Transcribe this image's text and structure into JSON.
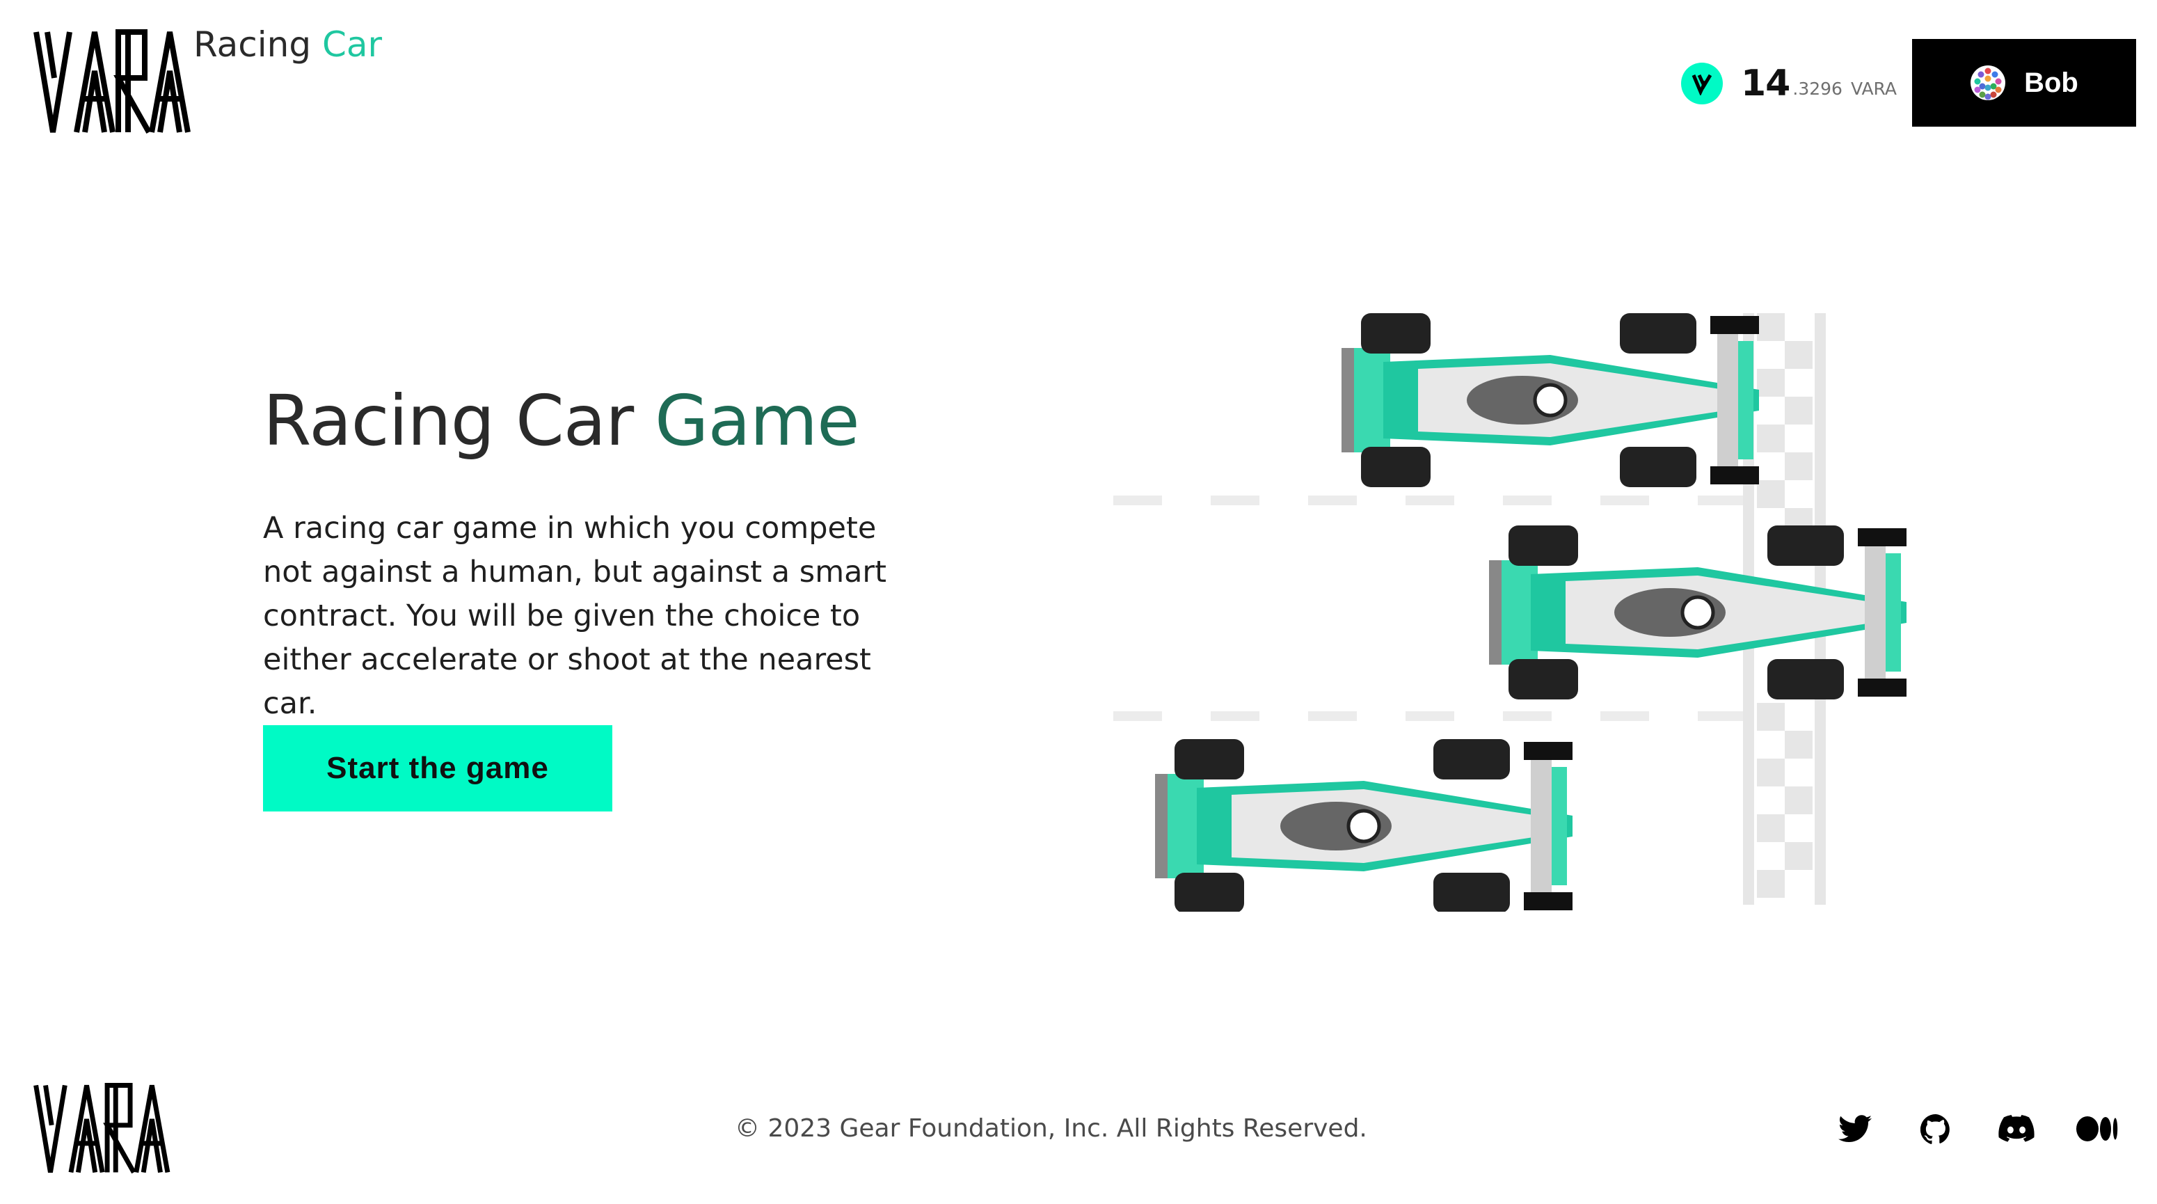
{
  "header": {
    "logo_alt": "VARA",
    "app_title_part1": "Racing",
    "app_title_part2": "Car",
    "balance": {
      "integer": "14",
      "decimal": ".3296",
      "unit": "VARA"
    },
    "account": {
      "name": "Bob"
    }
  },
  "hero": {
    "title_part1": "Racing Car",
    "title_part2": "Game",
    "description": "A racing car game in which you compete not against a human, but against a smart contract. You will be given the choice to either accelerate or shoot at the nearest car.",
    "start_button": "Start the game"
  },
  "footer": {
    "copyright": "© 2023 Gear Foundation, Inc. All Rights Reserved.",
    "socials": [
      "twitter-icon",
      "github-icon",
      "discord-icon",
      "medium-icon"
    ]
  },
  "colors": {
    "accent": "#00fac5",
    "title_accent": "#1e6b55",
    "header_accent": "#1fc7a0",
    "dark": "#000000"
  }
}
